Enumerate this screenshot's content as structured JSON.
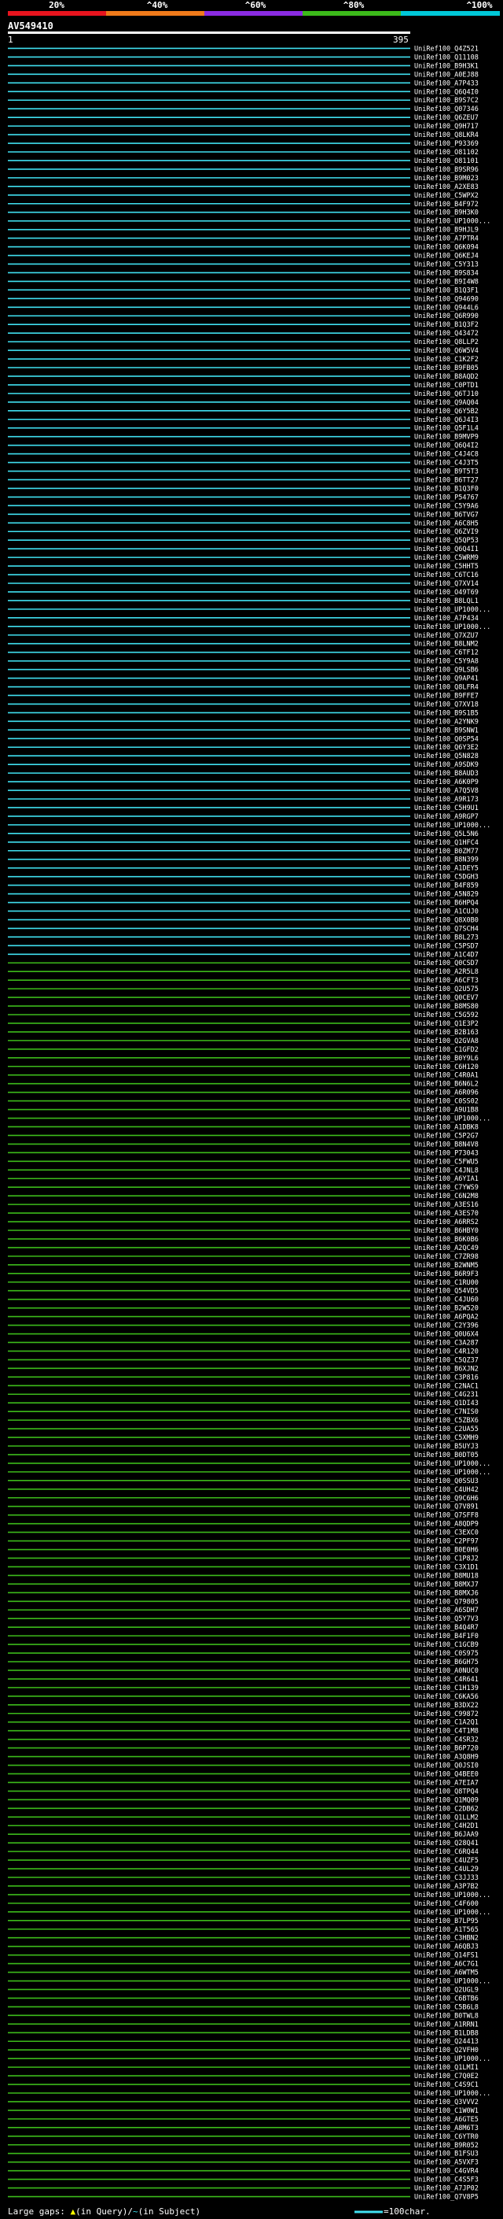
{
  "header": {
    "ticks": [
      "20%",
      "^40%",
      "^60%",
      "^80%",
      "^100%"
    ],
    "query_id": "AV549410",
    "query_start": "1",
    "query_end": "395"
  },
  "colors": {
    "cyan": "#40e0f0",
    "green": "#3cba1a",
    "white": "#ffffff",
    "yellow": "#ffff00",
    "background": "#000000",
    "colorbar": [
      "#e8141e",
      "#f07a1a",
      "#8a2be2",
      "#3cba1a",
      "#00c8d8"
    ]
  },
  "chart_data": {
    "type": "alignment-overview",
    "query_length": 395,
    "top_cyan_count": 106,
    "names": [
      "UniRef100_Q4Z521",
      "UniRef100_Q11108",
      "UniRef100_B9H3K1",
      "UniRef100_A0EJ88",
      "UniRef100_A7P433",
      "UniRef100_Q6Q4I0",
      "UniRef100_B9S7C2",
      "UniRef100_Q07346",
      "UniRef100_Q6ZEU7",
      "UniRef100_Q9H717",
      "UniRef100_Q8LKR4",
      "UniRef100_P93369",
      "UniRef100_O81102",
      "UniRef100_O81101",
      "UniRef100_B9SR96",
      "UniRef100_B9M023",
      "UniRef100_A2XE83",
      "UniRef100_C5WPX2",
      "UniRef100_B4F972",
      "UniRef100_B9H3K0",
      "UniRef100_UP1000...",
      "UniRef100_B9HJL9",
      "UniRef100_A7PTR4",
      "UniRef100_Q6K094",
      "UniRef100_Q6KEJ4",
      "UniRef100_C5Y313",
      "UniRef100_B9S834",
      "UniRef100_B9I4W8",
      "UniRef100_B1Q3F1",
      "UniRef100_Q94690",
      "UniRef100_Q944L6",
      "UniRef100_Q6R990",
      "UniRef100_B1Q3F2",
      "UniRef100_Q43472",
      "UniRef100_Q8LLP2",
      "UniRef100_Q6W5V4",
      "UniRef100_C1K2F2",
      "UniRef100_B9FB05",
      "UniRef100_B8AQD2",
      "UniRef100_C0PTD1",
      "UniRef100_Q6TJ10",
      "UniRef100_Q9AQ04",
      "UniRef100_Q6Y5B2",
      "UniRef100_Q6J4I3",
      "UniRef100_Q5F1L4",
      "UniRef100_B9MVP9",
      "UniRef100_Q6Q4I2",
      "UniRef100_C4J4C8",
      "UniRef100_C4J3T5",
      "UniRef100_B9T5T3",
      "UniRef100_B6TT27",
      "UniRef100_B1Q3F0",
      "UniRef100_P54767",
      "UniRef100_C5Y9A6",
      "UniRef100_B6TVG7",
      "UniRef100_A6C8H5",
      "UniRef100_Q6ZVI9",
      "UniRef100_Q5QP53",
      "UniRef100_Q6Q4I1",
      "UniRef100_C5WRM9",
      "UniRef100_C5HHT5",
      "UniRef100_C6TC16",
      "UniRef100_Q7XV14",
      "UniRef100_O49T69",
      "UniRef100_B8LQL1",
      "UniRef100_UP1000...",
      "UniRef100_A7P434",
      "UniRef100_UP1000...",
      "UniRef100_Q7XZU7",
      "UniRef100_B8LNM2",
      "UniRef100_C6TF12",
      "UniRef100_C5Y9A8",
      "UniRef100_Q9LSB6",
      "UniRef100_Q9AP41",
      "UniRef100_Q8LFR4",
      "UniRef100_B9FFE7",
      "UniRef100_Q7XV18",
      "UniRef100_B9S1B5",
      "UniRef100_A2YNK9",
      "UniRef100_B9SNW1",
      "UniRef100_Q0SP54",
      "UniRef100_Q6Y3E2",
      "UniRef100_Q5N828",
      "UniRef100_A9SDK9",
      "UniRef100_B8AUD3",
      "UniRef100_A6K0P9",
      "UniRef100_A7Q5V8",
      "UniRef100_A9R173",
      "UniRef100_C5H9U1",
      "UniRef100_A9RGP7",
      "UniRef100_UP1000...",
      "UniRef100_Q5L5N6",
      "UniRef100_Q1HFC4",
      "UniRef100_B0ZM77",
      "UniRef100_B8N399",
      "UniRef100_A1DEY5",
      "UniRef100_C5DGH3",
      "UniRef100_B4F859",
      "UniRef100_A5N829",
      "UniRef100_B6HPQ4",
      "UniRef100_A1CUJ0",
      "UniRef100_Q8X0B0",
      "UniRef100_Q7SCH4",
      "UniRef100_B8L273",
      "UniRef100_C5PSD7",
      "UniRef100_A1C4D7",
      "UniRef100_Q0CSD7",
      "UniRef100_A2R5L8",
      "UniRef100_A6CFT3",
      "UniRef100_Q2U575",
      "UniRef100_Q0CEV7",
      "UniRef100_B8MS80",
      "UniRef100_C5G592",
      "UniRef100_Q1E3P2",
      "UniRef100_B2B163",
      "UniRef100_Q2GVA8",
      "UniRef100_C1GFD2",
      "UniRef100_B0Y9L6",
      "UniRef100_C6H120",
      "UniRef100_C4R0A1",
      "UniRef100_B6N6L2",
      "UniRef100_A6R096",
      "UniRef100_C0SS02",
      "UniRef100_A9U1B8",
      "UniRef100_UP1000...",
      "UniRef100_A1DBK8",
      "UniRef100_C5P2G7",
      "UniRef100_B8N4V8",
      "UniRef100_P73043",
      "UniRef100_C5FWU5",
      "UniRef100_C4JNL8",
      "UniRef100_A6YIA1",
      "UniRef100_C7YWS9",
      "UniRef100_C6N2M8",
      "UniRef100_A3ES16",
      "UniRef100_A3ES70",
      "UniRef100_A6RRS2",
      "UniRef100_B6HBY0",
      "UniRef100_B6K0B6",
      "UniRef100_A2QC49",
      "UniRef100_C7ZR98",
      "UniRef100_B2WNM5",
      "UniRef100_B6R9F3",
      "UniRef100_C1RU00",
      "UniRef100_Q54VD5",
      "UniRef100_C4JU60",
      "UniRef100_B2W520",
      "UniRef100_A6PQA2",
      "UniRef100_C2Y396",
      "UniRef100_Q0U6X4",
      "UniRef100_C3A287",
      "UniRef100_C4R120",
      "UniRef100_C5QZ37",
      "UniRef100_B6XJN2",
      "UniRef100_C3P816",
      "UniRef100_C2NAC1",
      "UniRef100_C4G231",
      "UniRef100_Q1DI43",
      "UniRef100_C7NIS0",
      "UniRef100_C5ZBX6",
      "UniRef100_C2UA55",
      "UniRef100_C5XMH9",
      "UniRef100_B5UYJ3",
      "UniRef100_B0DT05",
      "UniRef100_UP1000...",
      "UniRef100_UP1000...",
      "UniRef100_Q0SSU3",
      "UniRef100_C4UH42",
      "UniRef100_Q9C6H6",
      "UniRef100_Q7V891",
      "UniRef100_Q7SFF8",
      "UniRef100_A8QDP9",
      "UniRef100_C3EXC0",
      "UniRef100_C2PF97",
      "UniRef100_B0E0H6",
      "UniRef100_C1P8J2",
      "UniRef100_C3X1D1",
      "UniRef100_B8MU18",
      "UniRef100_B8MXJ7",
      "UniRef100_B8MXJ6",
      "UniRef100_Q79805",
      "UniRef100_A6SDH7",
      "UniRef100_Q5Y7V3",
      "UniRef100_B4Q4R7",
      "UniRef100_B4F1F0",
      "UniRef100_C1GCB9",
      "UniRef100_C0S975",
      "UniRef100_B6GH75",
      "UniRef100_A0NUC0",
      "UniRef100_C4R641",
      "UniRef100_C1H139",
      "UniRef100_C6KA56",
      "UniRef100_B3DX22",
      "UniRef100_C99872",
      "UniRef100_C1A2Q1",
      "UniRef100_C4T1M8",
      "UniRef100_C4SR32",
      "UniRef100_B6P720",
      "UniRef100_A3Q8H9",
      "UniRef100_Q0JSI0",
      "UniRef100_Q4BEE0",
      "UniRef100_A7EIA7",
      "UniRef100_Q8TPQ4",
      "UniRef100_Q1MQ09",
      "UniRef100_C2DB62",
      "UniRef100_Q1LLM2",
      "UniRef100_C4H2D1",
      "UniRef100_B6JAA9",
      "UniRef100_Q28Q41",
      "UniRef100_C6RQ44",
      "UniRef100_C4UZF5",
      "UniRef100_C4UL29",
      "UniRef100_C3JJ33",
      "UniRef100_A3P7B2",
      "UniRef100_UP1000...",
      "UniRef100_C4F600",
      "UniRef100_UP1000...",
      "UniRef100_B7LP95",
      "UniRef100_A1T565",
      "UniRef100_C3HBN2",
      "UniRef100_A6QBJ3",
      "UniRef100_Q14FS1",
      "UniRef100_A6C7G1",
      "UniRef100_A6WTM5",
      "UniRef100_UP1000...",
      "UniRef100_Q2UGL9",
      "UniRef100_C6BTB6",
      "UniRef100_C5B6L8",
      "UniRef100_B0TWL8",
      "UniRef100_A1RRN1",
      "UniRef100_B1LDB8",
      "UniRef100_Q24413",
      "UniRef100_Q2VFH0",
      "UniRef100_UP1000...",
      "UniRef100_Q1LMI1",
      "UniRef100_C7Q0E2",
      "UniRef100_C4S9C1",
      "UniRef100_UP1000...",
      "UniRef100_Q3VVV2",
      "UniRef100_C1W0W1",
      "UniRef100_A6GTE5",
      "UniRef100_A8M6T3",
      "UniRef100_C6YTR0",
      "UniRef100_B9R052",
      "UniRef100_B1FSU3",
      "UniRef100_A5VXF3",
      "UniRef100_C4GVR4",
      "UniRef100_C4S5F3",
      "UniRef100_A7JP02",
      "UniRef100_Q7V8P5"
    ]
  },
  "footer": {
    "legend_prefix": "Large gaps:",
    "legend_in_query_marker": "▲",
    "legend_in_query": "(in Query)",
    "legend_sep": "/",
    "legend_in_subject_marker": "~",
    "legend_in_subject": "(in Subject)",
    "scale_label": "=100char."
  }
}
